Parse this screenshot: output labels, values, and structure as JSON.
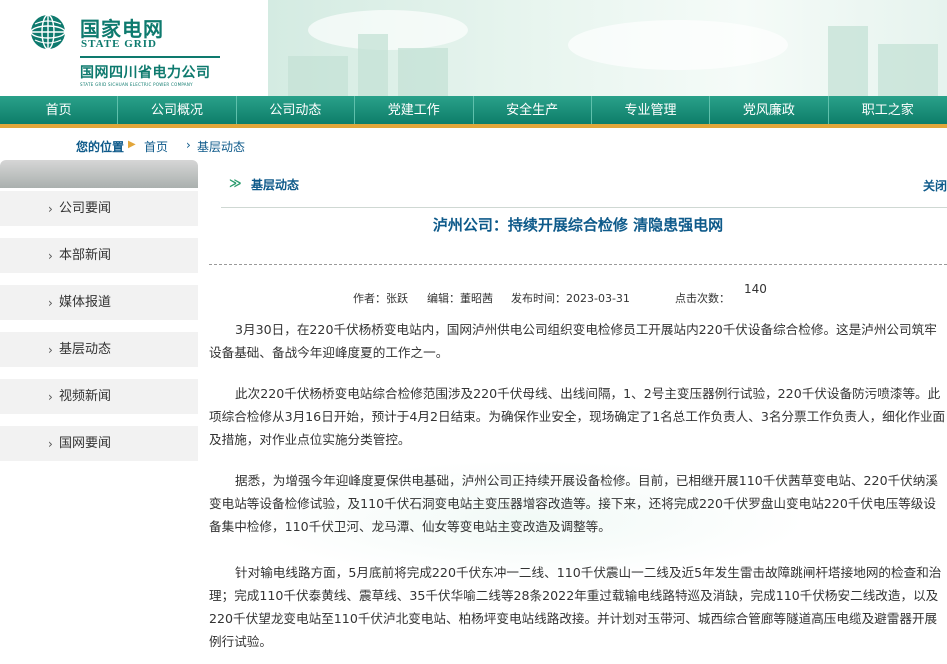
{
  "header": {
    "logo_cn": "国家电网",
    "logo_en": "STATE GRID",
    "logo_sub": "国网四川省电力公司",
    "logo_sub_en": "STATE GRID SICHUAN ELECTRIC POWER COMPANY"
  },
  "nav": [
    "首页",
    "公司概况",
    "公司动态",
    "党建工作",
    "安全生产",
    "专业管理",
    "党风廉政",
    "职工之家"
  ],
  "breadcrumb": {
    "label": "您的位置",
    "home": "首页",
    "current": "基层动态"
  },
  "sidebar": {
    "items": [
      "公司要闻",
      "本部新闻",
      "媒体报道",
      "基层动态",
      "视频新闻",
      "国网要闻"
    ]
  },
  "section": {
    "title": "基层动态",
    "right_link": "关闭"
  },
  "article": {
    "title": "泸州公司：持续开展综合检修 清隐患强电网",
    "author": "作者：张跃",
    "editor": "编辑：董昭茜",
    "date": "发布时间：2023-03-31",
    "clicks_label": "点击次数：",
    "clicks": "140",
    "paragraphs": [
      "3月30日，在220千伏杨桥变电站内，国网泸州供电公司组织变电检修员工开展站内220千伏设备综合检修。这是泸州公司筑牢设备基础、备战今年迎峰度夏的工作之一。",
      "此次220千伏杨桥变电站综合检修范围涉及220千伏母线、出线间隔，1、2号主变压器例行试验，220千伏设备防污喷漆等。此项综合检修从3月16日开始，预计于4月2日结束。为确保作业安全，现场确定了1名总工作负责人、3名分票工作负责人，细化作业面及措施，对作业点位实施分类管控。",
      "据悉，为增强今年迎峰度夏保供电基础，泸州公司正持续开展设备检修。目前，已相继开展110千伏茜草变电站、220千伏纳溪变电站等设备检修试验，及110千伏石洞变电站主变压器增容改造等。接下来，还将完成220千伏罗盘山变电站220千伏电压等级设备集中检修，110千伏卫河、龙马潭、仙女等变电站主变改造及调整等。",
      "针对输电线路方面，5月底前将完成220千伏东冲一二线、110千伏震山一二线及近5年发生雷击故障跳闸杆塔接地网的检查和治理；完成110千伏泰黄线、震草线、35千伏华喻二线等28条2022年重过载输电线路特巡及消缺，完成110千伏杨安二线改造，以及220千伏望龙变电站至110千伏泸北变电站、柏杨坪变电站线路改接。并计划对玉带河、城西综合管廊等隧道高压电缆及避雷器开展例行试验。"
    ]
  },
  "colors": {
    "brand_green": "#0e7a6e",
    "nav_top": "#2aa18a",
    "nav_bottom": "#0e7d69",
    "nav_underline": "#e2a63a",
    "link_blue": "#0e5a8a"
  }
}
